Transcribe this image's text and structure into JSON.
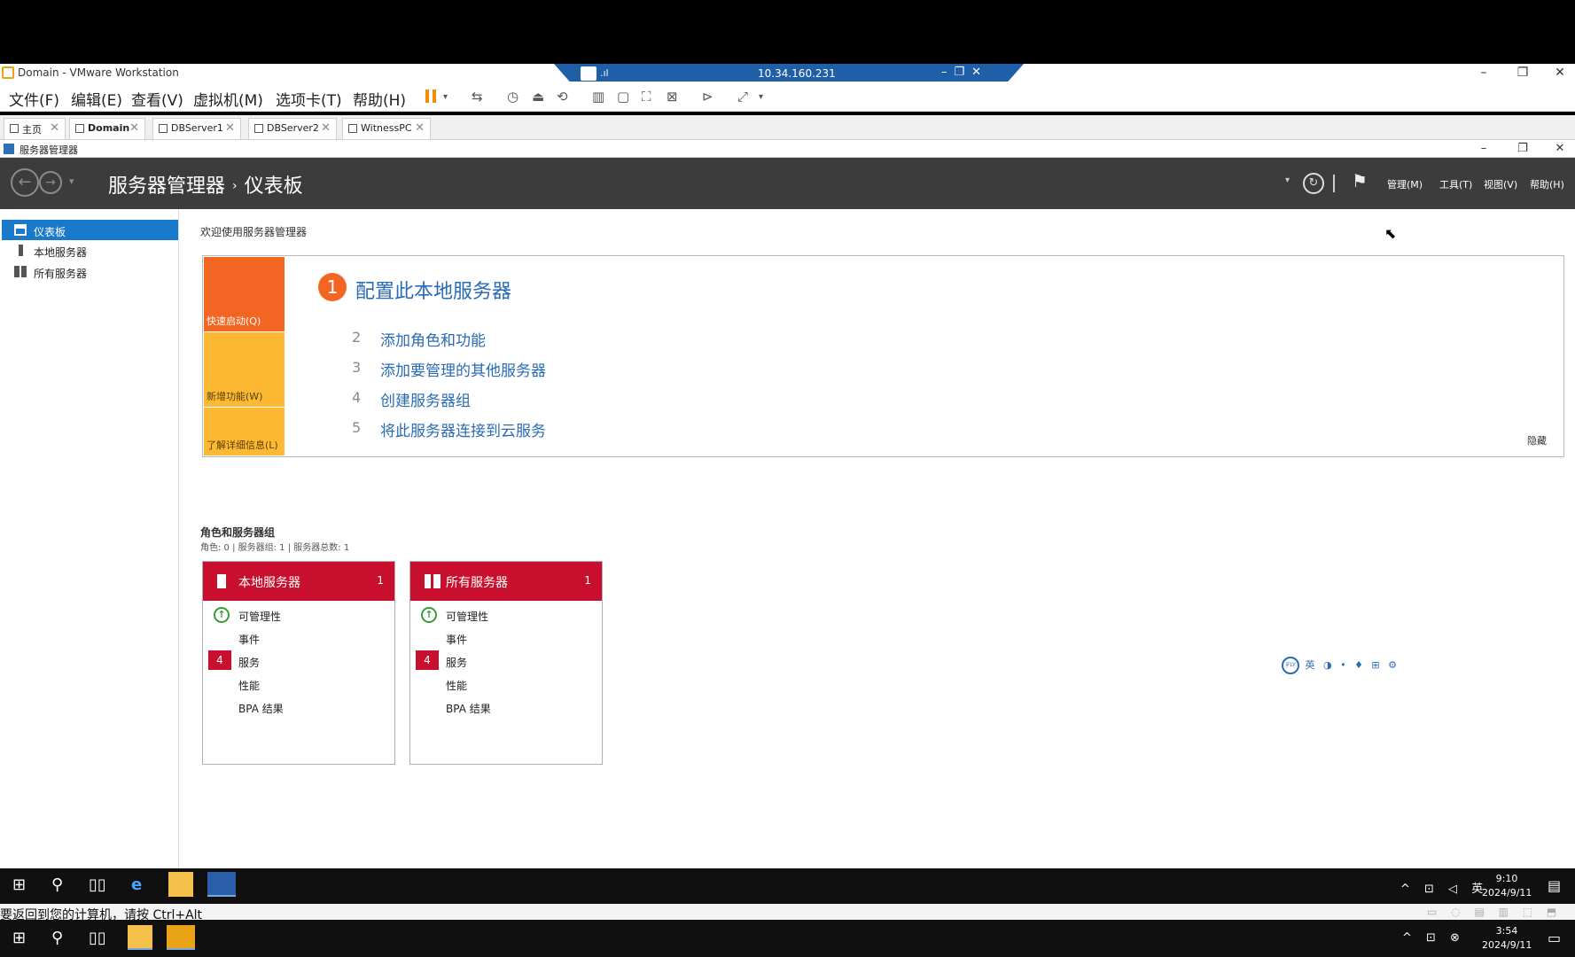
{
  "vmware": {
    "title": "Domain - VMware Workstation",
    "console_ip": "10.34.160.231",
    "menus": [
      "文件(F)",
      "编辑(E)",
      "查看(V)",
      "虚拟机(M)",
      "选项卡(T)",
      "帮助(H)"
    ],
    "tabs": [
      {
        "label": "主页"
      },
      {
        "label": "Domain"
      },
      {
        "label": "DBServer1"
      },
      {
        "label": "DBServer2"
      },
      {
        "label": "WitnessPC"
      }
    ],
    "status_text": "要返回到您的计算机，请按 Ctrl+Alt"
  },
  "server_manager": {
    "window_title": "服务器管理器",
    "breadcrumb_root": "服务器管理器",
    "breadcrumb_sep": "›",
    "breadcrumb_current": "仪表板",
    "header_menus": [
      "管理(M)",
      "工具(T)",
      "视图(V)",
      "帮助(H)"
    ],
    "sidebar": [
      {
        "label": "仪表板"
      },
      {
        "label": "本地服务器"
      },
      {
        "label": "所有服务器"
      }
    ],
    "welcome_title": "欢迎使用服务器管理器",
    "tiles": {
      "quick_start": "快速启动(Q)",
      "new_features": "新增功能(W)",
      "learn_more": "了解详细信息(L)"
    },
    "step1_num": "1",
    "step1_text": "配置此本地服务器",
    "steps": [
      {
        "num": "2",
        "text": "添加角色和功能"
      },
      {
        "num": "3",
        "text": "添加要管理的其他服务器"
      },
      {
        "num": "4",
        "text": "创建服务器组"
      },
      {
        "num": "5",
        "text": "将此服务器连接到云服务"
      }
    ],
    "hide": "隐藏",
    "roles_title": "角色和服务器组",
    "roles_summary": "角色: 0 | 服务器组: 1 | 服务器总数: 1",
    "cards": [
      {
        "title": "本地服务器",
        "count": "1",
        "manageability": "可管理性",
        "events": "事件",
        "services_badge": "4",
        "services": "服务",
        "performance": "性能",
        "bpa": "BPA 结果"
      },
      {
        "title": "所有服务器",
        "count": "1",
        "manageability": "可管理性",
        "events": "事件",
        "services_badge": "4",
        "services": "服务",
        "performance": "性能",
        "bpa": "BPA 结果"
      }
    ],
    "ime_bar": "英 ◑ • ♦ ⊞ ⚙"
  },
  "guest_taskbar": {
    "tray_lang": "英",
    "time": "9:10",
    "date": "2024/9/11"
  },
  "host_taskbar": {
    "time": "3:54",
    "date": "2024/9/11"
  },
  "colors": {
    "accent_blue": "#1979ca",
    "header_dark": "#3c3c3c",
    "quick_start_orange": "#f26522",
    "tile_yellow": "#fdb933",
    "card_red": "#c8102e",
    "link_blue": "#2a6bb5"
  }
}
